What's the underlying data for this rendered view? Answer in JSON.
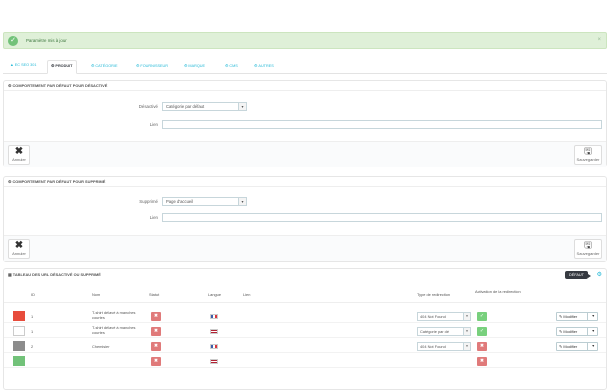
{
  "alert": {
    "icon": "check-circle-icon",
    "text": "Paramètre mis à jour",
    "close": "×"
  },
  "tabs": [
    {
      "icon": "chart-icon",
      "label": "EC SEO 301"
    },
    {
      "icon": "gear-icon",
      "label": "PRODUIT",
      "active": true
    },
    {
      "icon": "gear-icon",
      "label": "CATÉGORIE"
    },
    {
      "icon": "gear-icon",
      "label": "FOURNISSEUR"
    },
    {
      "icon": "gear-icon",
      "label": "MARQUE"
    },
    {
      "icon": "gear-icon",
      "label": "CMS"
    },
    {
      "icon": "gear-icon",
      "label": "AUTRES"
    }
  ],
  "panel1": {
    "title": "COMPORTEMENT PAR DÉFAUT POUR DÉSACTIVÉ",
    "select_label": "Désactivé",
    "select_value": "Catégorie par défaut",
    "link_label": "Lien",
    "cancel": "Annuler",
    "save": "Sauvegarder"
  },
  "panel2": {
    "title": "COMPORTEMENT PAR DÉFAUT POUR SUPPRIMÉ",
    "select_label": "Supprimé",
    "select_value": "Page d'accueil",
    "link_label": "Lien",
    "cancel": "Annuler",
    "save": "Sauvegarder"
  },
  "table": {
    "title": "TABLEAU DES URL DÉSACTIVÉ OU SUPPRIMÉ",
    "badge": "DÉFAUT",
    "columns": {
      "id": "ID",
      "name": "Nom",
      "status": "Statut",
      "lang": "Langue",
      "link": "Lien",
      "redirect": "Type de redirection",
      "activation": "Activation de la redirection"
    },
    "rows": [
      {
        "id": "1",
        "name": "T-shirt délavé à manches courtes",
        "lang_flag": "fr",
        "redirect": "404 Not Found",
        "active": true,
        "action": "Modifier",
        "thumb_color": "#e74c3c"
      },
      {
        "id": "1",
        "name": "T-shirt délavé à manches courtes",
        "lang_flag": "us",
        "redirect": "Catégorie par dé",
        "active": true,
        "action": "Modifier",
        "thumb_color": "#ffffff"
      },
      {
        "id": "2",
        "name": "Chemisier",
        "lang_flag": "fr",
        "redirect": "404 Not Found",
        "active": false,
        "action": "Modifier",
        "thumb_color": "#8c8c8c"
      },
      {
        "id": "",
        "name": "",
        "lang_flag": "us",
        "redirect": "",
        "active": false,
        "action": "",
        "thumb_color": "#72c279"
      }
    ]
  }
}
